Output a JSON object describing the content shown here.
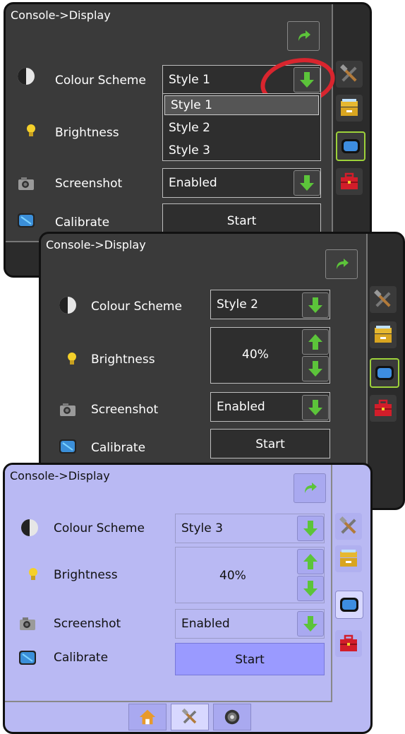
{
  "screens": [
    {
      "title": "Console->Display",
      "colour_scheme": {
        "label": "Colour Scheme",
        "value": "Style 1"
      },
      "brightness": {
        "label": "Brightness"
      },
      "dropdown_options": [
        "Style 1",
        "Style 2",
        "Style 3"
      ],
      "screenshot": {
        "label": "Screenshot",
        "value": "Enabled"
      },
      "calibrate": {
        "label": "Calibrate",
        "button": "Start"
      }
    },
    {
      "title": "Console->Display",
      "colour_scheme": {
        "label": "Colour Scheme",
        "value": "Style 2"
      },
      "brightness": {
        "label": "Brightness",
        "value": "40%"
      },
      "screenshot": {
        "label": "Screenshot",
        "value": "Enabled"
      },
      "calibrate": {
        "label": "Calibrate",
        "button": "Start"
      }
    },
    {
      "title": "Console->Display",
      "colour_scheme": {
        "label": "Colour Scheme",
        "value": "Style 3"
      },
      "brightness": {
        "label": "Brightness",
        "value": "40%"
      },
      "screenshot": {
        "label": "Screenshot",
        "value": "Enabled"
      },
      "calibrate": {
        "label": "Calibrate",
        "button": "Start"
      }
    }
  ],
  "icons": {
    "return": "return-arrow-icon",
    "down": "green-down-arrow-icon",
    "up": "green-up-arrow-icon",
    "tools": "tools-icon",
    "storage": "storage-box-icon",
    "console": "console-display-icon",
    "toolbox": "red-toolbox-icon",
    "home": "home-icon",
    "gps": "gps-icon"
  },
  "colors": {
    "dark_bg": "#2b2b2b",
    "light_bg": "#b9b9f3",
    "green_arrow": "#5cc43a",
    "highlight_circle": "#d9252e"
  }
}
